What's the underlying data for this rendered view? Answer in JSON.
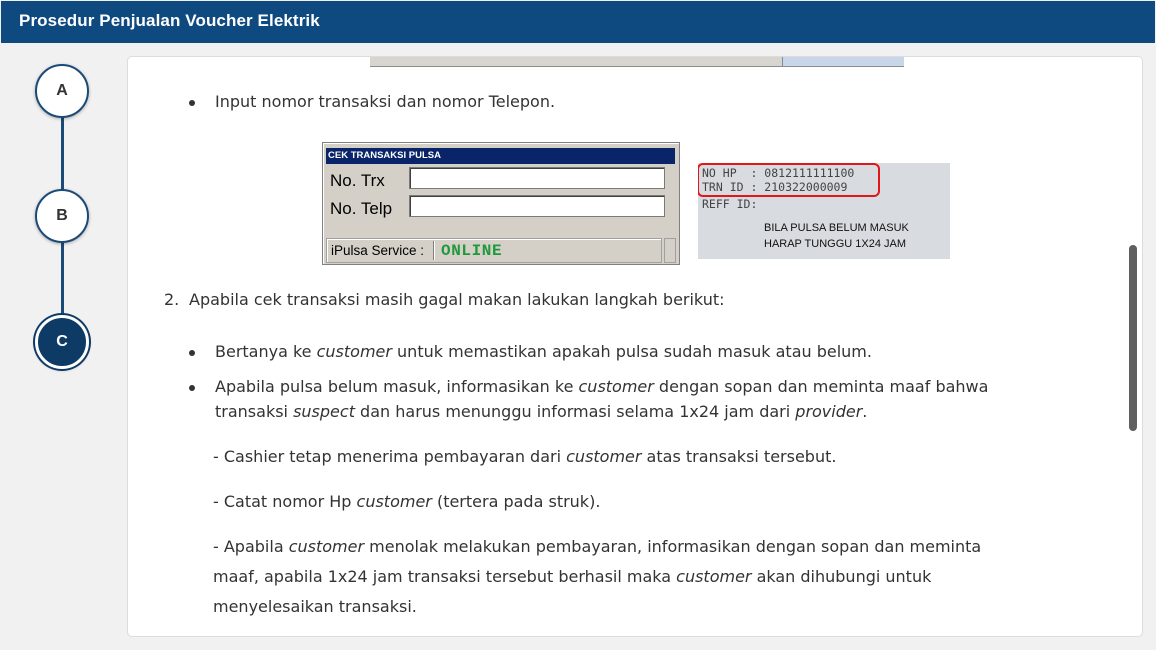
{
  "header": {
    "title": "Prosedur Penjualan Voucher Elektrik"
  },
  "steps": [
    {
      "label": "A",
      "active": false
    },
    {
      "label": "B",
      "active": false
    },
    {
      "label": "C",
      "active": true
    }
  ],
  "content": {
    "bullet_input": "Input nomor transaksi dan nomor Telepon.",
    "cek_window": {
      "title": "CEK TRANSAKSI PULSA",
      "trx_label": "No. Trx",
      "trx_value": "",
      "telp_label": "No. Telp",
      "telp_value": "",
      "service_label": "iPulsa Service :",
      "status": "ONLINE",
      "status_color": "#1f9a3a"
    },
    "receipt": {
      "line1": "NO HP  : 0812111111100",
      "line2": "TRN ID : 210322000009",
      "line3": "REFF ID:",
      "message1": "BILA PULSA BELUM MASUK",
      "message2": "HARAP TUNGGU 1X24 JAM",
      "highlight_color": "#e0161a"
    },
    "step2_number": "2.",
    "step2_text": "Apabila cek transaksi masih gagal makan lakukan langkah berikut:",
    "b1_pre": "Bertanya ke ",
    "b1_em": "customer",
    "b1_post": " untuk memastikan apakah pulsa sudah masuk atau belum.",
    "b2_l1_pre": "Apabila pulsa belum masuk, informasikan ke ",
    "b2_l1_em": "customer",
    "b2_l1_post": " dengan sopan dan meminta maaf bahwa",
    "b2_l2_pre": "transaksi ",
    "b2_l2_em1": "suspect",
    "b2_l2_mid": " dan harus menunggu informasi selama 1x24 jam dari ",
    "b2_l2_em2": "provider",
    "b2_l2_post": ".",
    "d1_pre": "- Cashier tetap menerima pembayaran dari ",
    "d1_em": "customer",
    "d1_post": " atas transaksi tersebut.",
    "d2_pre": "- Catat nomor Hp ",
    "d2_em": "customer",
    "d2_post": " (tertera pada struk).",
    "d3_l1_pre": "- Apabila ",
    "d3_l1_em": "customer",
    "d3_l1_post": " menolak melakukan pembayaran, informasikan dengan sopan dan meminta",
    "d3_l2_pre": "maaf, apabila 1x24 jam transaksi tersebut berhasil maka ",
    "d3_l2_em": "customer",
    "d3_l2_post": " akan dihubungi untuk",
    "d3_l3": "menyelesaikan transaksi."
  },
  "colors": {
    "header_bg": "#0e4a80",
    "step_active": "#0e3a66"
  }
}
